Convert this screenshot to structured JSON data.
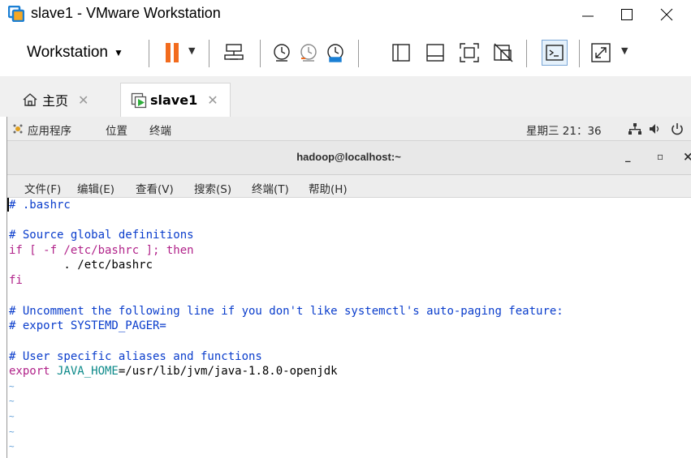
{
  "window": {
    "title": "slave1 - VMware Workstation"
  },
  "toolbar": {
    "workstation_label": "Workstation",
    "icons": [
      "pause-icon",
      "send-ctrl-alt-del-icon",
      "snapshot-take-icon",
      "snapshot-revert-icon",
      "snapshot-manager-icon",
      "library-icon",
      "thumbnail-bar-icon",
      "full-screen-icon",
      "unity-icon",
      "console-view-icon",
      "stretch-guest-icon"
    ]
  },
  "tabs": [
    {
      "label": "主页",
      "icon": "home-icon"
    },
    {
      "label": "slave1",
      "icon": "vm-icon"
    }
  ],
  "gnome_panel": {
    "applications": "应用程序",
    "places": "位置",
    "terminal": "终端",
    "clock": "星期三 21：36"
  },
  "terminal": {
    "title": "hadoop@localhost:~",
    "minimize": "_",
    "maximize": "▫",
    "close": "×",
    "menu": [
      "文件(F)",
      "编辑(E)",
      "查看(V)",
      "搜索(S)",
      "终端(T)",
      "帮助(H)"
    ],
    "lines": {
      "l1": "# .bashrc",
      "l3": "# Source global definitions",
      "l4_if": "if",
      "l4_mid": " [ -f /etc/bashrc ]; ",
      "l4_then": "then",
      "l5": "        . /etc/bashrc",
      "l6": "fi",
      "l8": "# Uncomment the following line if you don't like systemctl's auto-paging feature:",
      "l9": "# export SYSTEMD_PAGER=",
      "l11": "# User specific aliases and functions",
      "l12_export": "export",
      "l12_var": " JAVA_HOME",
      "l12_rest": "=/usr/lib/jvm/java-1.8.0-openjdk",
      "tilde": "~"
    }
  },
  "colors": {
    "comment": "#0a3dcc",
    "keyword": "#b1238a",
    "variable": "#0d8a8a",
    "pause_orange": "#f26b1d",
    "vmware_blue": "#1a7fd4"
  }
}
